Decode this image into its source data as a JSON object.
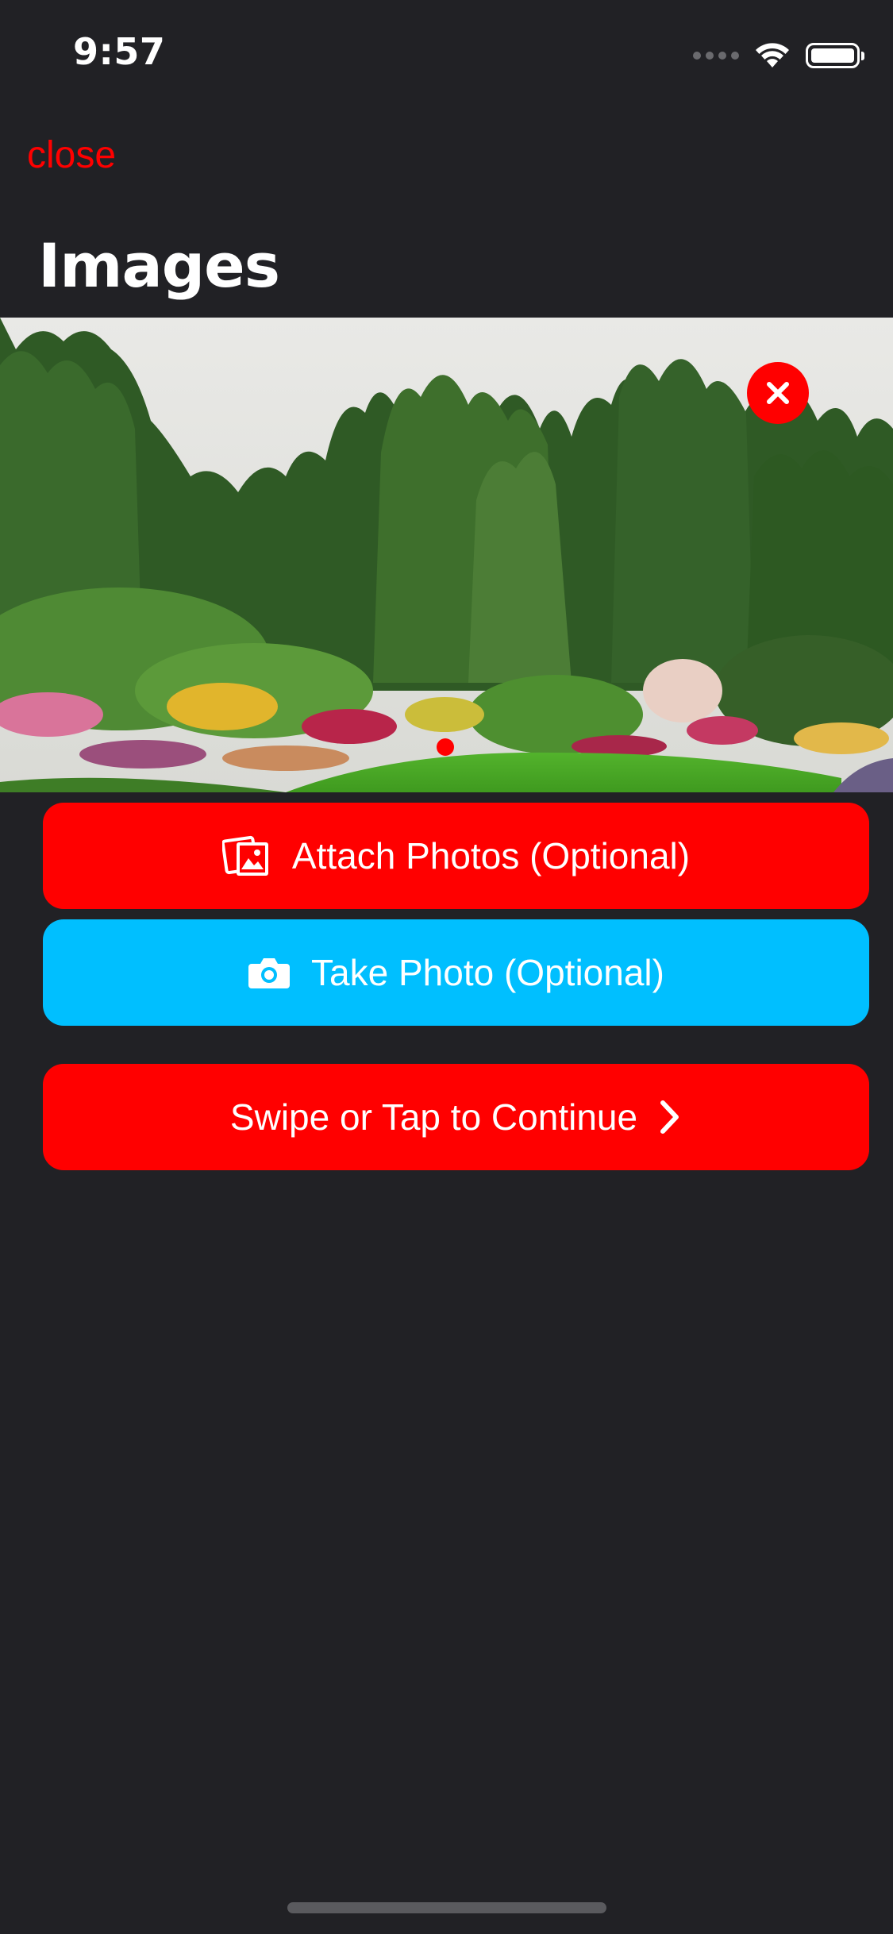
{
  "status_bar": {
    "time": "9:57"
  },
  "nav": {
    "close_label": "close",
    "title": "Images"
  },
  "carousel": {
    "page_count": 1,
    "current_page": 1,
    "image_subject": "garden landscape with trees and flower beds"
  },
  "buttons": {
    "attach_label": "Attach Photos (Optional)",
    "take_label": "Take Photo (Optional)",
    "continue_label": "Swipe or Tap to Continue"
  },
  "colors": {
    "background": "#212125",
    "accent_red": "#ff0000",
    "accent_blue": "#00bfff",
    "text": "#ffffff"
  },
  "icons": {
    "attach": "photos-icon",
    "take": "camera-icon",
    "continue": "chevron-right-icon",
    "remove": "close-x-icon"
  }
}
